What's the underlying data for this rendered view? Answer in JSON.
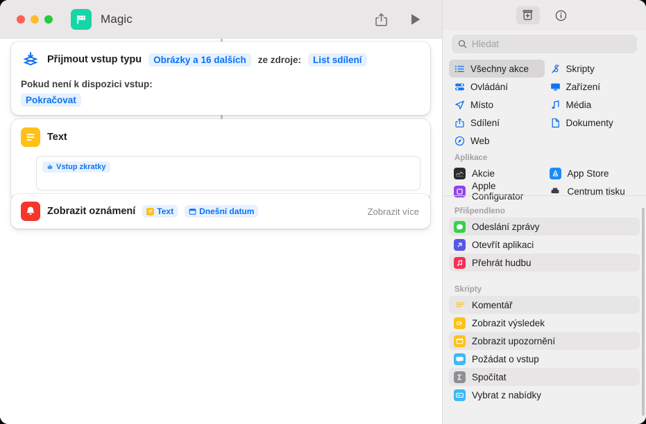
{
  "window": {
    "title": "Magic",
    "app_icon_color": "#18d5a8",
    "traffic_lights": [
      "close",
      "minimize",
      "zoom"
    ]
  },
  "toolbar": {
    "share_label": "share-icon",
    "run_label": "play-icon"
  },
  "actions": [
    {
      "icon": "receive-input-icon",
      "icon_color": "#1273f0",
      "title": "Přijmout vstup typu",
      "pill_types": "Obrázky a 16 dalších",
      "mid_label": "ze zdroje:",
      "pill_source": "List sdílení",
      "sub_label": "Pokud není k dispozici vstup:",
      "pill_fallback": "Pokračovat"
    },
    {
      "icon": "text-icon",
      "icon_color": "#ffc116",
      "title": "Text",
      "token": "Vstup zkratky"
    },
    {
      "icon": "notification-icon",
      "icon_color": "#f4362d",
      "title": "Zobrazit oznámení",
      "chips": [
        "Text",
        "Dnešní datum"
      ],
      "more_label": "Zobrazit více"
    }
  ],
  "sidebar": {
    "tools": [
      {
        "name": "action-library-icon",
        "active": true
      },
      {
        "name": "info-icon",
        "active": false
      }
    ],
    "search": {
      "placeholder": "Hledat"
    },
    "categories": [
      {
        "label": "Všechny akce",
        "icon": "list-icon",
        "selected": true
      },
      {
        "label": "Skripty",
        "icon": "script-icon",
        "selected": false
      },
      {
        "label": "Ovládání",
        "icon": "controls-icon",
        "selected": false
      },
      {
        "label": "Zařízení",
        "icon": "device-icon",
        "selected": false
      },
      {
        "label": "Místo",
        "icon": "location-icon",
        "selected": false
      },
      {
        "label": "Média",
        "icon": "media-icon",
        "selected": false
      },
      {
        "label": "Sdílení",
        "icon": "share-icon",
        "selected": false
      },
      {
        "label": "Dokumenty",
        "icon": "documents-icon",
        "selected": false
      },
      {
        "label": "Web",
        "icon": "web-icon",
        "selected": false
      }
    ],
    "sections": [
      {
        "title": "Aplikace",
        "items": [
          {
            "label": "Akcie",
            "icon": "stocks-app-icon",
            "color": "#2b2b30"
          },
          {
            "label": "App Store",
            "icon": "appstore-app-icon",
            "color": "#1a8cf5"
          },
          {
            "label": "Apple Configurator",
            "icon": "configurator-app-icon",
            "color": "#8e44ec"
          },
          {
            "label": "Centrum tisku",
            "icon": "printcenter-app-icon",
            "color": "#5a5a5e"
          }
        ]
      },
      {
        "title": "Přišpendleno",
        "items": [
          {
            "label": "Odeslání zprávy",
            "icon": "messages-icon",
            "color": "#35d14a"
          },
          {
            "label": "Otevřít aplikaci",
            "icon": "open-app-icon",
            "color": "#5856e6"
          },
          {
            "label": "Přehrát hudbu",
            "icon": "music-icon",
            "color": "#fa2d55"
          }
        ]
      },
      {
        "title": "Skripty",
        "items": [
          {
            "label": "Komentář",
            "icon": "comment-icon",
            "color": "#ffc116"
          },
          {
            "label": "Zobrazit výsledek",
            "icon": "show-result-icon",
            "color": "#ffc116"
          },
          {
            "label": "Zobrazit upozornění",
            "icon": "show-alert-icon",
            "color": "#ffc116"
          },
          {
            "label": "Požádat o vstup",
            "icon": "ask-input-icon",
            "color": "#3cb9f7"
          },
          {
            "label": "Spočítat",
            "icon": "count-icon",
            "color": "#8e8e93"
          },
          {
            "label": "Vybrat z nabídky",
            "icon": "choose-menu-icon",
            "color": "#3cb9f7"
          }
        ]
      }
    ]
  }
}
